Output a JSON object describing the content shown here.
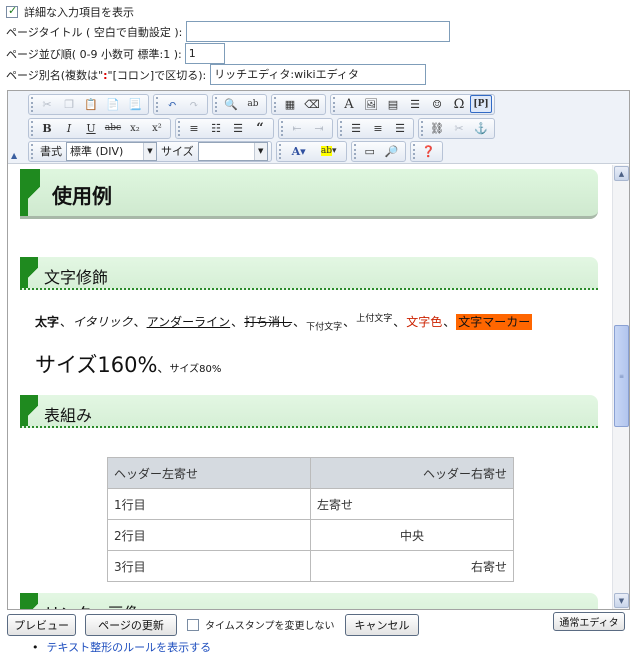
{
  "options": {
    "show_details_label": "詳細な入力項目を表示",
    "page_title_label": "ページタイトル ( 空白で自動設定 ):",
    "page_title_value": "",
    "page_order_label": "ページ並び順( 0-9 小数可 標準:1 ):",
    "page_order_value": "1",
    "alias_label_pre": "ページ別名(複数は\"",
    "alias_colon": ":",
    "alias_label_post": "\"[コロン]で区切る):",
    "alias_value": "リッチエディタ:wikiエディタ"
  },
  "toolbar": {
    "format_label": "書式",
    "format_value": "標準 (DIV)",
    "size_label": "サイズ",
    "size_value": ""
  },
  "content": {
    "h2_title": "使用例",
    "section_decoration": "文字修飾",
    "deco": {
      "bold": "太字",
      "italic": "イタリック",
      "underline": "アンダーライン",
      "strike": "打ち消し",
      "sub": "下付文字",
      "sup": "上付文字",
      "color": "文字色",
      "marker": "文字マーカー",
      "sep": "、"
    },
    "size_large": "サイズ160%",
    "size_small": "サイズ80%",
    "section_table": "表組み",
    "table": {
      "header_left": "ヘッダー左寄せ",
      "header_right": "ヘッダー右寄せ",
      "rows": [
        {
          "label": "1行目",
          "value": "左寄せ"
        },
        {
          "label": "2行目",
          "value": "中央"
        },
        {
          "label": "3行目",
          "value": "右寄せ"
        }
      ]
    },
    "section_link_partial": "リンク・画像"
  },
  "colors": {
    "accent_green": "#1f8a1f",
    "text_color_red": "#cc2200",
    "marker_bg": "#ff6600"
  },
  "buttons": {
    "preview": "プレビュー",
    "update": "ページの更新",
    "keep_timestamp": "タイムスタンプを変更しない",
    "cancel": "キャンセル",
    "normal_editor": "通常エディタ"
  },
  "link_rules": "テキスト整形のルールを表示する"
}
